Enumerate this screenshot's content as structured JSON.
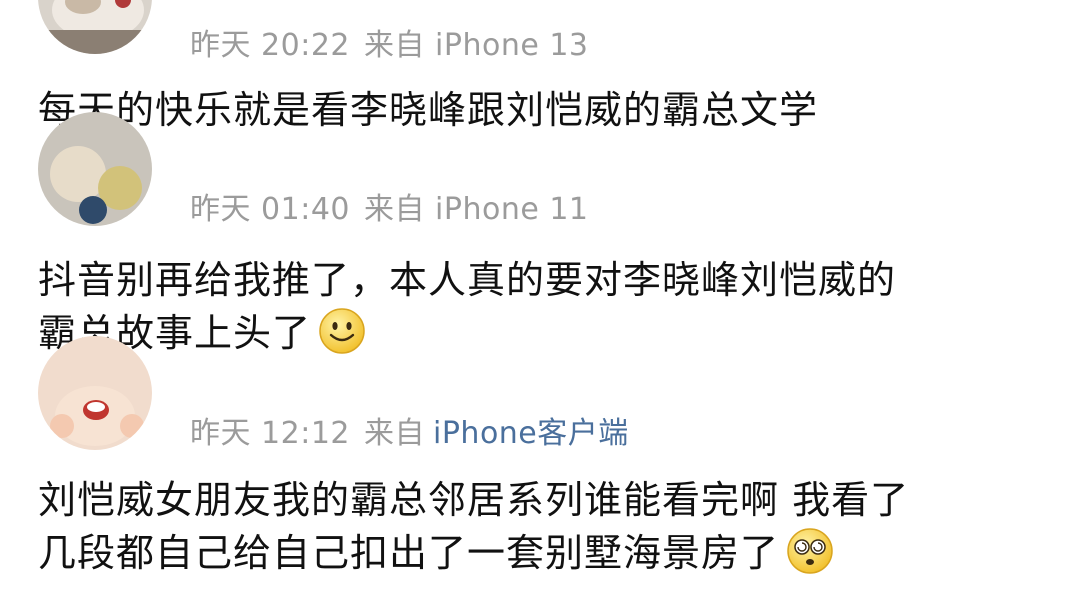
{
  "comments": [
    {
      "time": "昨天 20:22",
      "source": "来自 iPhone 13",
      "text_lines": [
        "每天的快乐就是看李晓峰跟刘恺威的霸总文学"
      ],
      "emoji": ""
    },
    {
      "time": "昨天 01:40",
      "source": "来自 iPhone 11",
      "text_lines": [
        "抖音别再给我推了，本人真的要对李晓峰刘恺威的",
        "霸总故事上头了"
      ],
      "emoji": "smile-emoji"
    },
    {
      "time": "昨天 12:12",
      "source_prefix": "来自",
      "source_link": "iPhone客户端",
      "text_lines": [
        "刘恺威女朋友我的霸总邻居系列谁能看完啊 我看了",
        "几段都自己给自己扣出了一套别墅海景房了"
      ],
      "emoji": "dizzy-eyes-emoji"
    }
  ]
}
